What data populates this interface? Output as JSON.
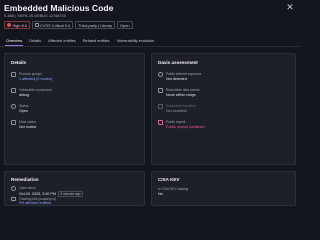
{
  "header": {
    "title": "Embedded Malicious Code",
    "subtitle": "S-868 | SNYK-JS-DEBUG-12768745",
    "badges": {
      "severity": "High 8.6",
      "cvss": "CVSS Critical 9.3",
      "type": "Third-party | Library",
      "status": "Open"
    }
  },
  "tabs": [
    "Overview",
    "Details",
    "Affected entities",
    "Related entities",
    "Vulnerability evolution"
  ],
  "details": {
    "title": "Details",
    "process_groups_label": "Process groups",
    "process_groups_value": "1 affected (0 muted)",
    "component_label": "Vulnerable component",
    "component_value": "debug",
    "status_label": "Status",
    "status_value": "Open",
    "mute_label": "Mute status",
    "mute_value": "Not muted"
  },
  "davis": {
    "title": "Davis assessment",
    "exposure_label": "Public internet exposure",
    "exposure_value": "Not detected",
    "assets_label": "Reachable data assets",
    "assets_value": "None within range",
    "functions_label": "Vulnerable functions",
    "functions_value": "Not available",
    "exploit_label": "Public exploit",
    "exploit_value": "Public exploit published"
  },
  "remediation": {
    "title": "Remediation",
    "open_since_label": "Open since",
    "open_since_value": "Oct 20, 2025, 3:40 PM",
    "open_since_chip": "5 minutes ago",
    "tracking_label": "Tracking link (unassign it)",
    "tracking_value": "0% affected entities"
  },
  "cisa": {
    "title": "CISA KEV",
    "label": "In CISA KEV catalog",
    "value": "No"
  },
  "colors": {
    "background": "#14161d",
    "card": "#1d2029",
    "accent": "#8c7bf0",
    "link": "#8ea2ff",
    "danger": "#e24a5f",
    "exploit": "#f05a8c"
  }
}
